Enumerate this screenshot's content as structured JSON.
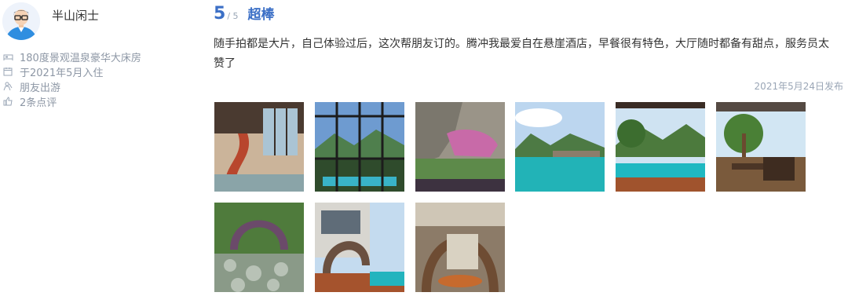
{
  "user": {
    "name": "半山闲士"
  },
  "meta": {
    "room": "180度景观温泉豪华大床房",
    "checkin": "于2021年5月入住",
    "trip_type": "朋友出游",
    "review_count": "2条点评"
  },
  "rating": {
    "score": "5",
    "max": "/ 5",
    "word": "超棒"
  },
  "review": {
    "text": "随手拍都是大片，自己体验过后，这次帮朋友订的。腾冲我最爱自在悬崖酒店，早餐很有特色，大厅随时都备有甜点，服务员太赞了",
    "date": "2021年5月24日发布"
  },
  "photos_count": 9,
  "colors": {
    "accent": "#3b6fc6",
    "muted": "#8d97a5"
  }
}
